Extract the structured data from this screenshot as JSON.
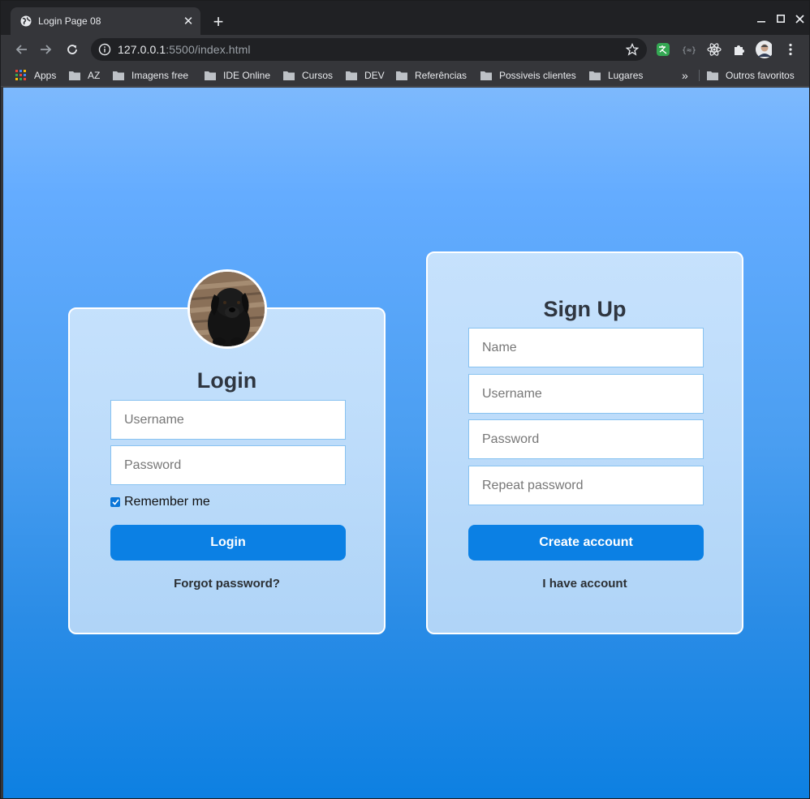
{
  "browser": {
    "tab_title": "Login Page 08",
    "tab_close": "✕",
    "new_tab": "+",
    "url_host": "127.0.0.1",
    "url_rest": ":5500/index.html",
    "bookmarks": [
      {
        "label": "Apps",
        "icon": "apps-grid-icon"
      },
      {
        "label": "AZ",
        "icon": "folder-icon"
      },
      {
        "label": "Imagens free",
        "icon": "folder-icon"
      },
      {
        "label": "IDE Online",
        "icon": "folder-icon"
      },
      {
        "label": "Cursos",
        "icon": "folder-icon"
      },
      {
        "label": "DEV",
        "icon": "folder-icon"
      },
      {
        "label": "Referências",
        "icon": "folder-icon"
      },
      {
        "label": "Possiveis clientes",
        "icon": "folder-icon"
      },
      {
        "label": "Lugares",
        "icon": "folder-icon"
      }
    ],
    "more_bookmarks": "»",
    "other_bookmarks": "Outros favoritos"
  },
  "login": {
    "title": "Login",
    "username_placeholder": "Username",
    "password_placeholder": "Password",
    "remember_label": "Remember me",
    "remember_checked": true,
    "button_label": "Login",
    "forgot_link": "Forgot password?"
  },
  "signup": {
    "title": "Sign Up",
    "name_placeholder": "Name",
    "username_placeholder": "Username",
    "password_placeholder": "Password",
    "repeat_placeholder": "Repeat password",
    "button_label": "Create account",
    "have_account_link": "I have account"
  },
  "colors": {
    "primary_button": "#0b80e4",
    "page_gradient_top": "#7db9fd",
    "page_gradient_bottom": "#0d80e2"
  }
}
